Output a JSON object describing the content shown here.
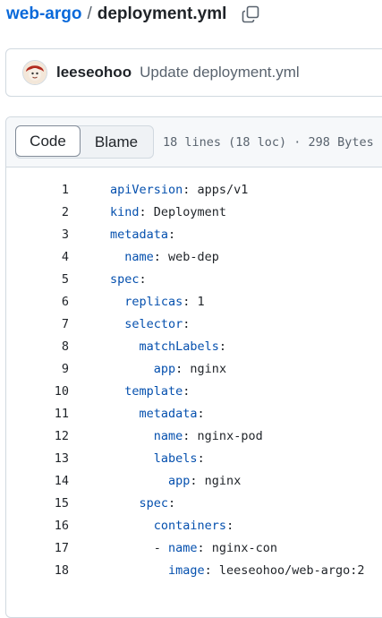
{
  "breadcrumb": {
    "repo": "web-argo",
    "separator": "/",
    "file": "deployment.yml"
  },
  "commit": {
    "author": "leeseohoo",
    "message": "Update deployment.yml"
  },
  "file_header": {
    "tabs": [
      "Code",
      "Blame"
    ],
    "active_tab": "Code",
    "meta": "18 lines (18 loc) · 298 Bytes"
  },
  "colors": {
    "link": "#0969da",
    "yaml_key": "#0550ae",
    "text": "#1f2328",
    "muted": "#59636e"
  },
  "code_lines": [
    {
      "n": "1",
      "indent": "",
      "key": "apiVersion",
      "rest": ": apps/v1"
    },
    {
      "n": "2",
      "indent": "",
      "key": "kind",
      "rest": ": Deployment"
    },
    {
      "n": "3",
      "indent": "",
      "key": "metadata",
      "rest": ":"
    },
    {
      "n": "4",
      "indent": "  ",
      "key": "name",
      "rest": ": web-dep"
    },
    {
      "n": "5",
      "indent": "",
      "key": "spec",
      "rest": ":"
    },
    {
      "n": "6",
      "indent": "  ",
      "key": "replicas",
      "rest": ": 1"
    },
    {
      "n": "7",
      "indent": "  ",
      "key": "selector",
      "rest": ":"
    },
    {
      "n": "8",
      "indent": "    ",
      "key": "matchLabels",
      "rest": ":"
    },
    {
      "n": "9",
      "indent": "      ",
      "key": "app",
      "rest": ": nginx"
    },
    {
      "n": "10",
      "indent": "  ",
      "key": "template",
      "rest": ":"
    },
    {
      "n": "11",
      "indent": "    ",
      "key": "metadata",
      "rest": ":"
    },
    {
      "n": "12",
      "indent": "      ",
      "key": "name",
      "rest": ": nginx-pod"
    },
    {
      "n": "13",
      "indent": "      ",
      "key": "labels",
      "rest": ":"
    },
    {
      "n": "14",
      "indent": "        ",
      "key": "app",
      "rest": ": nginx"
    },
    {
      "n": "15",
      "indent": "    ",
      "key": "spec",
      "rest": ":"
    },
    {
      "n": "16",
      "indent": "      ",
      "key": "containers",
      "rest": ":"
    },
    {
      "n": "17",
      "indent": "      - ",
      "key": "name",
      "rest": ": nginx-con"
    },
    {
      "n": "18",
      "indent": "        ",
      "key": "image",
      "rest": ": leeseohoo/web-argo:2"
    }
  ]
}
